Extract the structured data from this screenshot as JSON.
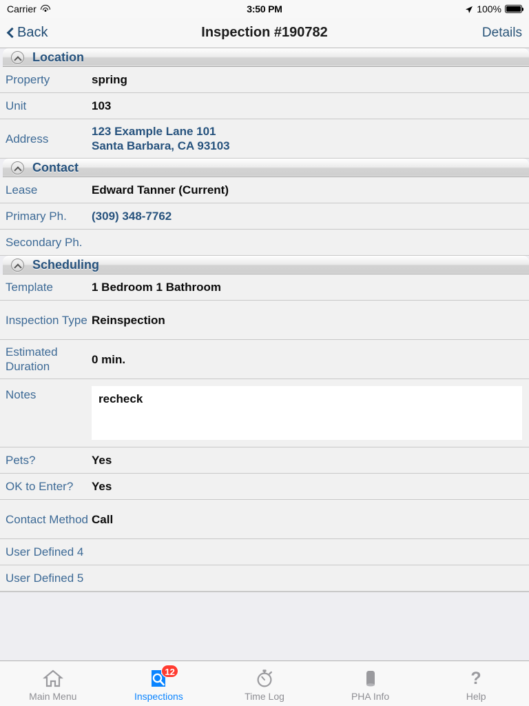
{
  "status_bar": {
    "carrier": "Carrier",
    "wifi_icon": "wifi-icon",
    "time": "3:50 PM",
    "location_icon": "location-arrow-icon",
    "battery_percent": "100%",
    "battery_icon": "battery-full-icon"
  },
  "nav_bar": {
    "back_label": "Back",
    "back_icon": "chevron-left-icon",
    "title": "Inspection #190782",
    "right_label": "Details"
  },
  "sections": [
    {
      "title": "Location",
      "toggle_icon": "chevron-up-circle-icon",
      "rows": [
        {
          "label": "Property",
          "value": "spring",
          "style": "plain"
        },
        {
          "label": "Unit",
          "value": "103",
          "style": "plain"
        },
        {
          "label": "Address",
          "value": "123 Example Lane 101\nSanta Barbara, CA 93103",
          "style": "link"
        }
      ]
    },
    {
      "title": "Contact",
      "toggle_icon": "chevron-up-circle-icon",
      "rows": [
        {
          "label": "Lease",
          "value": "Edward Tanner (Current)",
          "style": "plain"
        },
        {
          "label": "Primary Ph.",
          "value": "(309) 348-7762",
          "style": "link"
        },
        {
          "label": "Secondary Ph.",
          "value": "",
          "style": "plain"
        }
      ]
    },
    {
      "title": "Scheduling",
      "toggle_icon": "chevron-up-circle-icon",
      "rows": [
        {
          "label": "Template",
          "value": "1 Bedroom 1 Bathroom",
          "style": "plain"
        },
        {
          "label": "Inspection Type",
          "value": "Reinspection",
          "style": "plain"
        },
        {
          "label": "Estimated Duration",
          "value": "0 min.",
          "style": "plain"
        },
        {
          "label": "Notes",
          "value": "recheck",
          "style": "textarea",
          "placeholder": ""
        },
        {
          "label": "Pets?",
          "value": "Yes",
          "style": "plain"
        },
        {
          "label": "OK to Enter?",
          "value": "Yes",
          "style": "plain"
        },
        {
          "label": "Contact Method",
          "value": "Call",
          "style": "plain"
        },
        {
          "label": "User Defined 4",
          "value": "",
          "style": "plain"
        },
        {
          "label": "User Defined 5",
          "value": "",
          "style": "plain"
        }
      ]
    }
  ],
  "tab_bar": {
    "tabs": [
      {
        "label": "Main Menu",
        "icon": "home-icon",
        "active": false,
        "badge": ""
      },
      {
        "label": "Inspections",
        "icon": "document-search-icon",
        "active": true,
        "badge": "12"
      },
      {
        "label": "Time Log",
        "icon": "stopwatch-icon",
        "active": false,
        "badge": ""
      },
      {
        "label": "PHA Info",
        "icon": "database-icon",
        "active": false,
        "badge": ""
      },
      {
        "label": "Help",
        "icon": "question-mark-icon",
        "active": false,
        "badge": ""
      }
    ]
  },
  "colors": {
    "accent_blue": "#0a84ff",
    "label_blue": "#3d6a96",
    "link_blue": "#26527d",
    "badge_red": "#ff3b30",
    "row_bg": "#f1f1f1",
    "page_bg": "#eeeef2"
  }
}
